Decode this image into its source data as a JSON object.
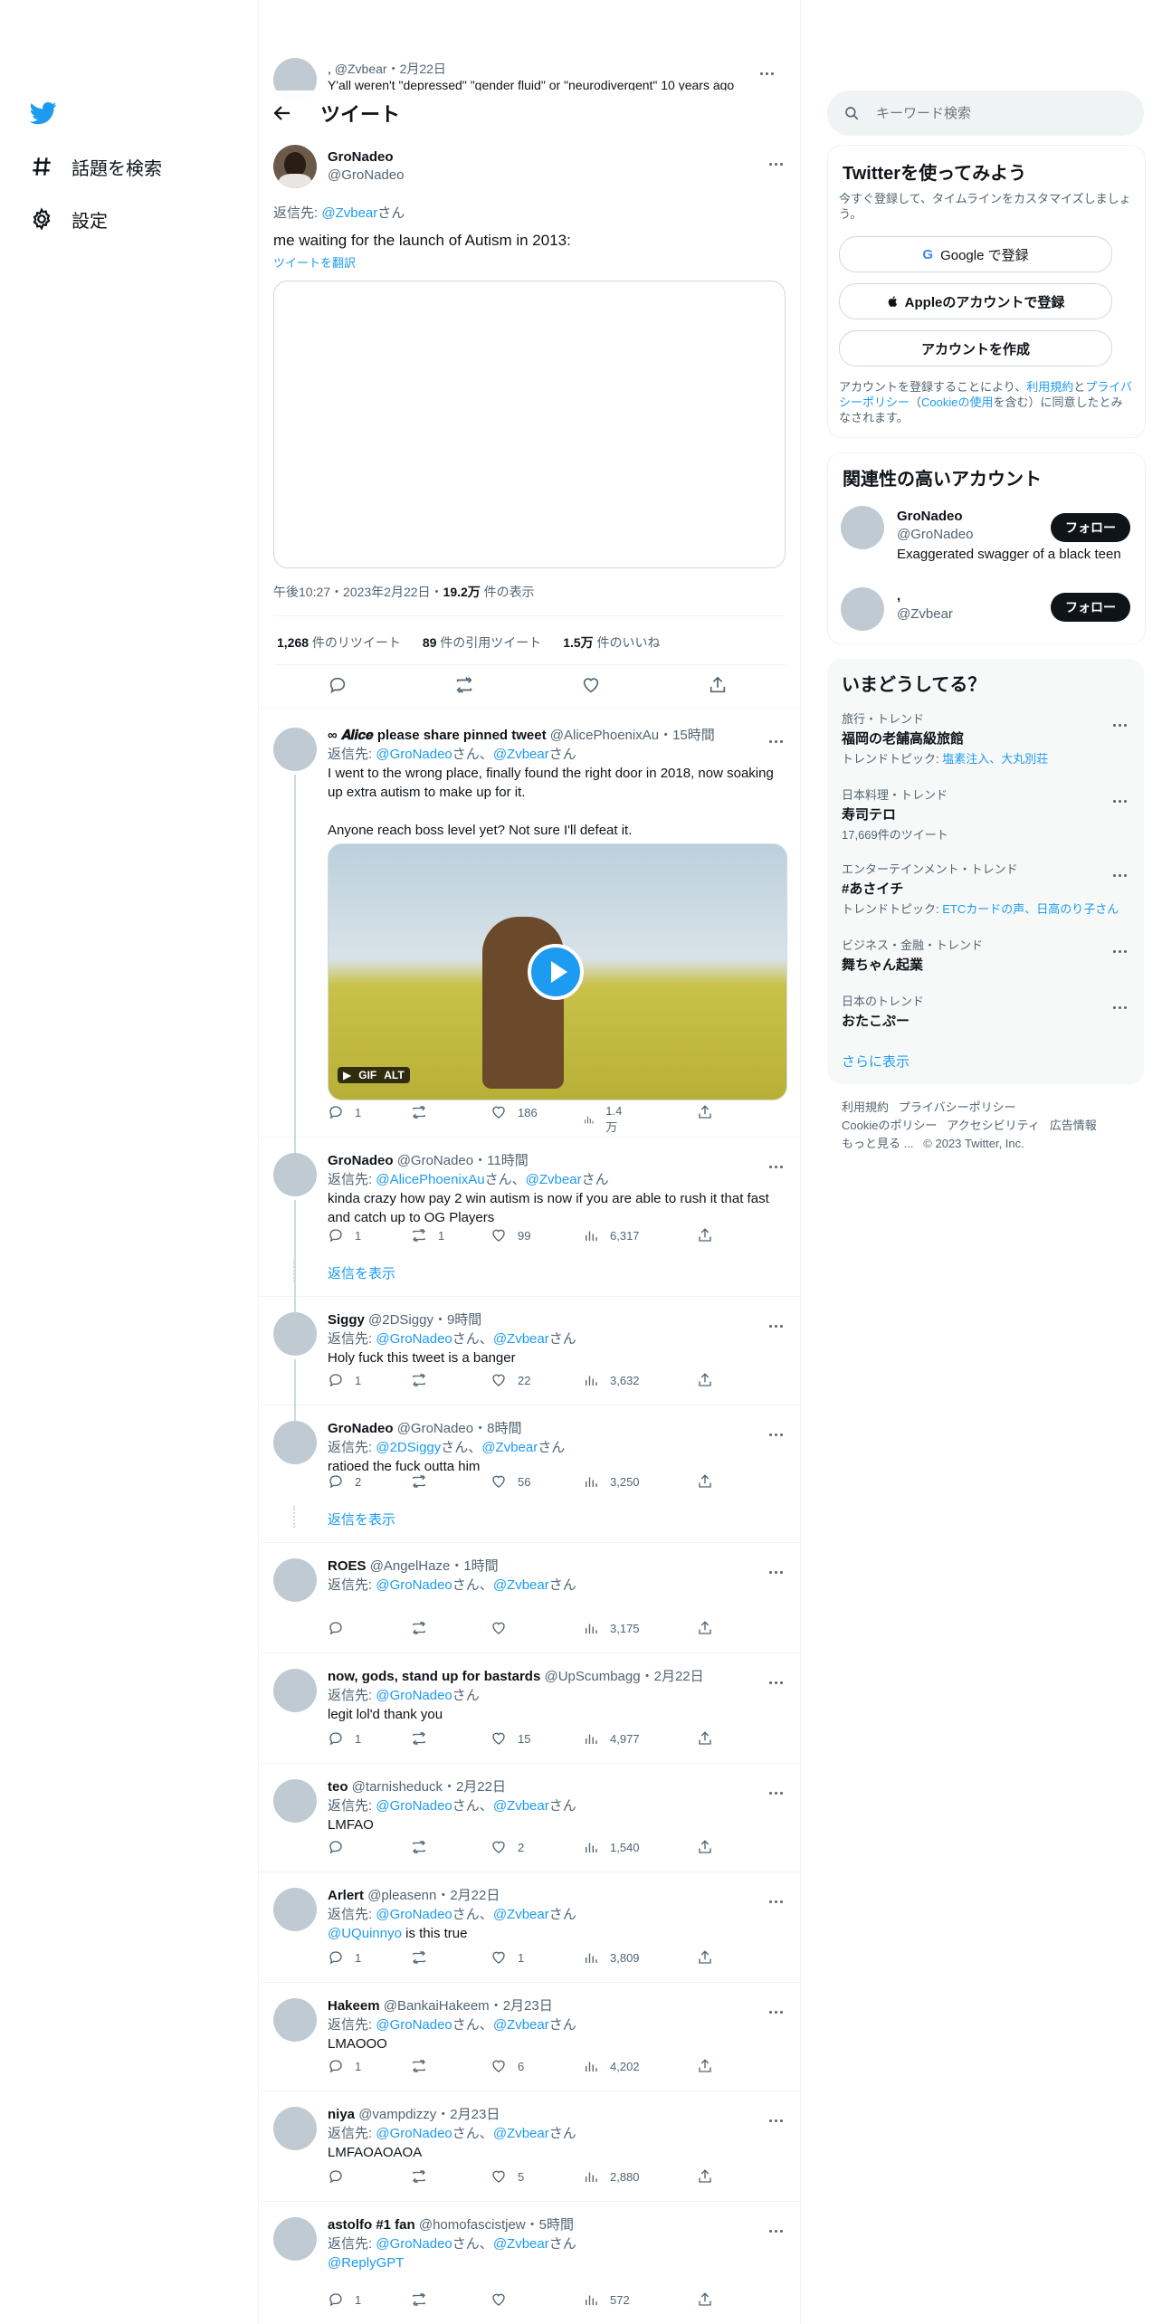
{
  "nav": {
    "explore": "話題を検索",
    "settings": "設定"
  },
  "ghost": {
    "name": ",",
    "handle": "@Zvbear",
    "date": "2月22日",
    "text": "Y'all weren't \"depressed\" \"gender fluid\" or \"neurodivergent\" 10 years ago"
  },
  "header": {
    "title": "ツイート"
  },
  "tweet": {
    "name": "GroNadeo",
    "handle": "@GroNadeo",
    "reply_prefix": "返信先: ",
    "reply_to": "@Zvbear",
    "reply_suffix": "さん",
    "text": "me waiting for the launch of Autism in 2013:",
    "translate": "ツイートを翻訳",
    "time": "午後10:27・2023年2月22日・",
    "views_num": "19.2万",
    "views_label": " 件の表示",
    "retweets_num": "1,268",
    "retweets_label": " 件のリツイート",
    "quotes_num": "89",
    "quotes_label": " 件の引用ツイート",
    "likes_num": "1.5万",
    "likes_label": " 件のいいね"
  },
  "replies": [
    {
      "name": "∞ 𝑨𝒍𝒊𝒄𝒆 please share pinned tweet",
      "handle": "@AlicePhoenixAu",
      "time": "15時間",
      "to": [
        "@GroNadeo",
        "@Zvbear"
      ],
      "text": "I went to the wrong place, finally found the right door in 2018, now soaking up extra autism to make up for it.\n\nAnyone reach boss level yet? Not sure I'll defeat it.",
      "replies": "1",
      "retweets": "",
      "likes": "186",
      "views": "1.4万",
      "media": {
        "badges": [
          "GIF",
          "ALT"
        ]
      }
    },
    {
      "name": "GroNadeo",
      "handle": "@GroNadeo",
      "time": "11時間",
      "to": [
        "@AlicePhoenixAu",
        "@Zvbear"
      ],
      "text": "kinda crazy how pay 2 win autism is now if you are able to rush it that fast and catch up to OG Players",
      "replies": "1",
      "retweets": "1",
      "likes": "99",
      "views": "6,317"
    },
    {
      "name": "Siggy",
      "handle": "@2DSiggy",
      "time": "9時間",
      "to": [
        "@GroNadeo",
        "@Zvbear"
      ],
      "text": "Holy fuck this tweet is a banger",
      "replies": "1",
      "retweets": "",
      "likes": "22",
      "views": "3,632"
    },
    {
      "name": "GroNadeo",
      "handle": "@GroNadeo",
      "time": "8時間",
      "to": [
        "@2DSiggy",
        "@Zvbear"
      ],
      "text": "ratioed the fuck outta him",
      "replies": "2",
      "retweets": "",
      "likes": "56",
      "views": "3,250"
    },
    {
      "name": "ROES",
      "handle": "@AngelHaze",
      "time": "1時間",
      "to": [
        "@GroNadeo",
        "@Zvbear"
      ],
      "text": "",
      "replies": "",
      "retweets": "",
      "likes": "",
      "views": "3,175"
    },
    {
      "name": "now, gods, stand up for bastards",
      "handle": "@UpScumbagg",
      "time": "2月22日",
      "to": [
        "@GroNadeo"
      ],
      "text": "legit lol'd thank you",
      "replies": "1",
      "retweets": "",
      "likes": "15",
      "views": "4,977"
    },
    {
      "name": "teo",
      "handle": "@tarnisheduck",
      "time": "2月22日",
      "to": [
        "@GroNadeo",
        "@Zvbear"
      ],
      "text": "LMFAO",
      "replies": "",
      "retweets": "",
      "likes": "2",
      "views": "1,540"
    },
    {
      "name": "Arlert",
      "handle": "@pleasenn",
      "time": "2月22日",
      "to": [
        "@GroNadeo",
        "@Zvbear"
      ],
      "text_mention": "@UQuinnyo",
      "text": " is this true",
      "replies": "1",
      "retweets": "",
      "likes": "1",
      "views": "3,809"
    },
    {
      "name": "Hakeem",
      "handle": "@BankaiHakeem",
      "time": "2月23日",
      "to": [
        "@GroNadeo",
        "@Zvbear"
      ],
      "text": "LMAOOO",
      "replies": "1",
      "retweets": "",
      "likes": "6",
      "views": "4,202"
    },
    {
      "name": "niya",
      "handle": "@vampdizzy",
      "time": "2月23日",
      "to": [
        "@GroNadeo",
        "@Zvbear"
      ],
      "text": "LMFAOAOAOA",
      "replies": "",
      "retweets": "",
      "likes": "5",
      "views": "2,880"
    },
    {
      "name": "astolfo #1 fan",
      "handle": "@homofascistjew",
      "time": "5時間",
      "to": [
        "@GroNadeo",
        "@Zvbear"
      ],
      "text_mention": "@ReplyGPT",
      "text": "",
      "replies": "1",
      "retweets": "",
      "likes": "",
      "views": "572"
    }
  ],
  "reply_common": {
    "prefix": "返信先: ",
    "san": "さん",
    "sep": "、",
    "dot": "・"
  },
  "show_replies": "返信を表示",
  "sidebar": {
    "search_placeholder": "キーワード検索",
    "signup": {
      "title": "Twitterを使ってみよう",
      "desc": "今すぐ登録して、タイムラインをカスタマイズしましょう。",
      "google": "Google で登録",
      "apple": "Appleのアカウントで登録",
      "create": "アカウントを作成",
      "legal_1": "アカウントを登録することにより、",
      "legal_terms": "利用規約",
      "legal_2": "と",
      "legal_privacy": "プライバシーポリシー",
      "legal_3": "（",
      "legal_cookie": "Cookieの使用",
      "legal_4": "を含む）に同意したとみなされます。"
    },
    "relevant": {
      "title": "関連性の高いアカウント",
      "accounts": [
        {
          "name": "GroNadeo",
          "handle": "@GroNadeo",
          "bio": "Exaggerated swagger of a black teen",
          "follow": "フォロー"
        },
        {
          "name": ",",
          "handle": "@Zvbear",
          "bio": "",
          "follow": "フォロー"
        }
      ]
    },
    "trends": {
      "title": "いまどうしてる？",
      "items": [
        {
          "category": "旅行・トレンド",
          "name": "福岡の老舗高級旅館",
          "sub_label": "トレンドトピック: ",
          "sub_links": "塩素注入、大丸別荘"
        },
        {
          "category": "日本料理・トレンド",
          "name": "寿司テロ",
          "sub": "17,669件のツイート"
        },
        {
          "category": "エンターテインメント・トレンド",
          "name": "#あさイチ",
          "sub_label": "トレンドトピック: ",
          "sub_links": "ETCカードの声、日高のり子さん"
        },
        {
          "category": "ビジネス・金融・トレンド",
          "name": "舞ちゃん起業"
        },
        {
          "category": "日本のトレンド",
          "name": "おたこぷー"
        }
      ],
      "show_more": "さらに表示"
    },
    "footer": {
      "line1": [
        "利用規約",
        "プライバシーポリシー"
      ],
      "line2": [
        "Cookieのポリシー",
        "アクセシビリティ",
        "広告情報"
      ],
      "more": "もっと見る ...",
      "copyright": "© 2023 Twitter, Inc."
    }
  },
  "colors": {
    "accent": "#1d9bf0",
    "text": "#0f1419",
    "muted": "#536471",
    "border": "#eff3f4"
  }
}
